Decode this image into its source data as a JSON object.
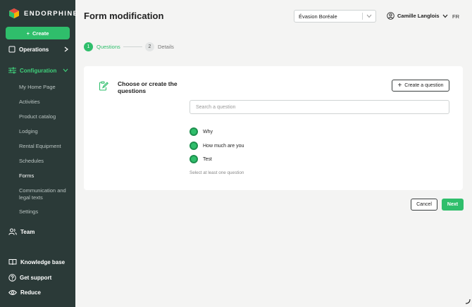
{
  "sidebar": {
    "brand": "ENDORPHINE",
    "create_label": "Create",
    "operations_label": "Operations",
    "configuration_label": "Configuration",
    "config_items": [
      "My Home Page",
      "Activities",
      "Product catalog",
      "Lodging",
      "Rental Equipment",
      "Schedules",
      "Forms",
      "Communication and legal texts",
      "Settings"
    ],
    "team_label": "Team",
    "knowledge_label": "Knowledge base",
    "support_label": "Get support",
    "reduce_label": "Reduce"
  },
  "header": {
    "title": "Form modification",
    "organization": "Évasion Boréale",
    "user_name": "Camille Langlois",
    "language": "FR"
  },
  "stepper": {
    "step1_number": "1",
    "step1_label": "Questions",
    "step2_number": "2",
    "step2_label": "Details"
  },
  "card": {
    "title": "Choose or create the questions",
    "create_question_label": "Create a question",
    "search_placeholder": "Search a question",
    "questions": [
      "Why",
      "How much are you",
      "Test"
    ],
    "hint": "Select at least one question"
  },
  "footer": {
    "cancel_label": "Cancel",
    "next_label": "Next"
  },
  "colors": {
    "accent": "#2fbe6b",
    "sidebar_bg": "#2b3a38",
    "page_bg": "#f4f4f3"
  }
}
